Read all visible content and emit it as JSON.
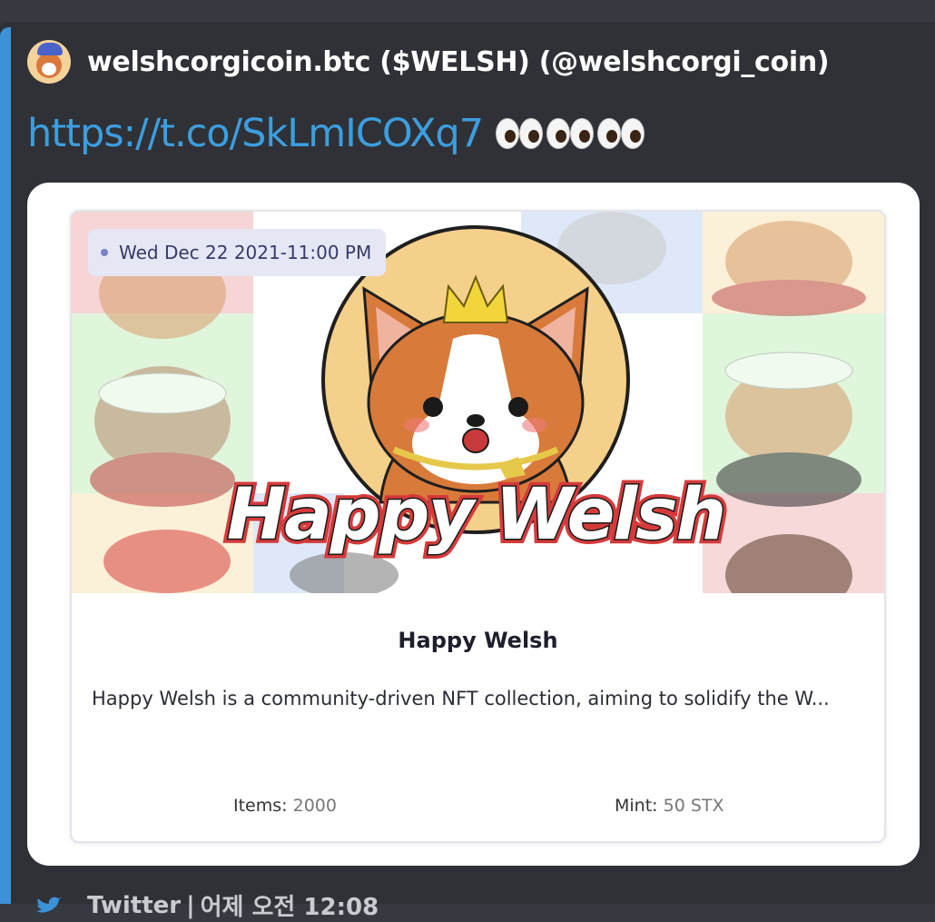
{
  "author": {
    "name": "welshcorgicoin.btc ($WELSH) (@welshcorgi_coin)",
    "avatar_icon": "corgi-avatar-icon"
  },
  "message": {
    "link_text": "https://t.co/SkLmICOXq7",
    "eyes_emoji": "👀👀👀"
  },
  "card": {
    "date_chip": "Wed Dec 22 2021-11:00 PM",
    "banner_text": "Happy Welsh",
    "title": "Happy Welsh",
    "description": "Happy Welsh is a community-driven NFT collection, aiming to solidify the W...",
    "items_label": "Items:",
    "items_value": "2000",
    "mint_label": "Mint:",
    "mint_value": "50 STX"
  },
  "footer": {
    "source": "Twitter",
    "separator": "|",
    "timestamp": "어제 오전 12:08",
    "icon": "twitter-bird-icon"
  },
  "colors": {
    "background": "#36393f",
    "embed_bg": "#2f3136",
    "accent": "#3b92d8",
    "link": "#3c9ee0"
  }
}
